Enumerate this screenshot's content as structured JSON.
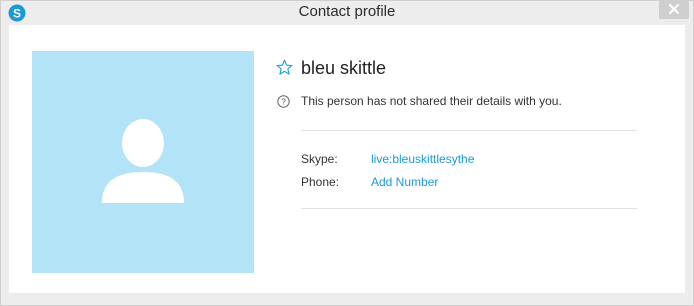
{
  "window": {
    "title": "Contact profile",
    "app_icon": "skype-icon",
    "accent_color": "#1a9ad6",
    "avatar_bg": "#b3e3f7"
  },
  "profile": {
    "name": "bleu skittle",
    "favorite_icon": "star-outline-icon",
    "help_icon": "question-circle-icon",
    "notice": "This person has not shared their details with you.",
    "fields": [
      {
        "label": "Skype:",
        "value": "live:bleuskittlesythe"
      },
      {
        "label": "Phone:",
        "value": "Add Number"
      }
    ]
  }
}
